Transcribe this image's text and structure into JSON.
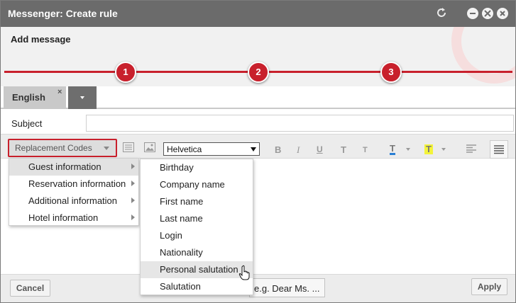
{
  "window": {
    "title": "Messenger: Create rule"
  },
  "wizard": {
    "heading": "Add message",
    "steps": [
      "1",
      "2",
      "3"
    ]
  },
  "tabs": {
    "language": "English",
    "close_glyph": "×"
  },
  "subject": {
    "label": "Subject",
    "value": ""
  },
  "toolbar": {
    "replacement_codes_label": "Replacement Codes",
    "font": "Helvetica",
    "bold": "B",
    "italic": "I",
    "underline": "U",
    "superscript": "T",
    "subscript": "T",
    "text_color": "T",
    "highlight": "T"
  },
  "replacement_menu": {
    "items": [
      "Guest information",
      "Reservation information",
      "Additional information",
      "Hotel information"
    ]
  },
  "guest_submenu": {
    "items": [
      "Birthday",
      "Company name",
      "First name",
      "Last name",
      "Login",
      "Nationality",
      "Personal salutation",
      "Salutation"
    ]
  },
  "footer": {
    "cancel_label": "Cancel",
    "apply_label": "Apply",
    "example_text": "e.g. Dear Ms. ..."
  },
  "colors": {
    "accent": "#c8202c",
    "titlebar": "#6b6b6b",
    "text_color_bar": "#2a7fd4",
    "highlight_bg": "#f3f33a"
  },
  "icons": {
    "refresh": "refresh-icon",
    "minimize": "minimize-icon",
    "maximize": "maximize-icon",
    "close": "close-icon",
    "list": "list-icon",
    "image": "image-icon",
    "align_left": "align-left-icon",
    "justify": "justify-icon",
    "cursor": "hand-cursor-icon"
  }
}
